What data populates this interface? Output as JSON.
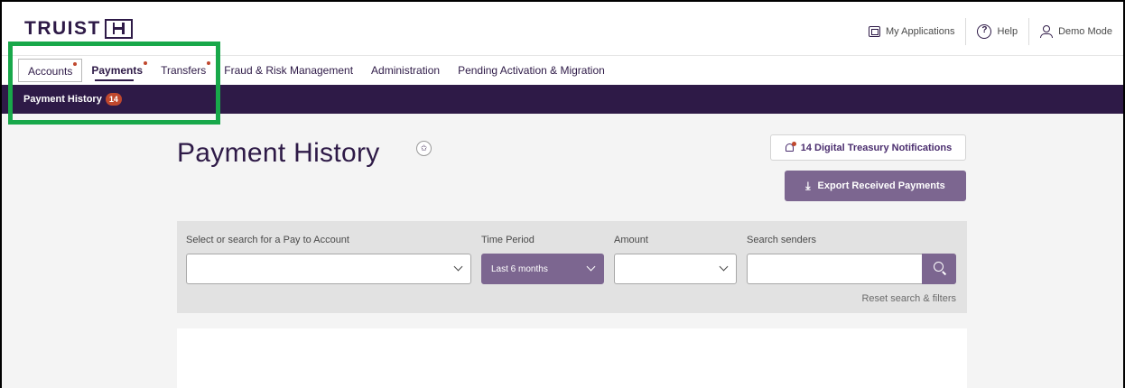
{
  "brand": {
    "name": "TRUIST"
  },
  "utility": {
    "my_applications": "My Applications",
    "help": "Help",
    "demo_mode": "Demo Mode"
  },
  "nav": {
    "items": [
      {
        "label": "Accounts"
      },
      {
        "label": "Payments"
      },
      {
        "label": "Transfers"
      },
      {
        "label": "Fraud & Risk Management"
      },
      {
        "label": "Administration"
      },
      {
        "label": "Pending Activation & Migration"
      }
    ]
  },
  "subnav": {
    "label": "Payment History",
    "badge": "14"
  },
  "page": {
    "title": "Payment History",
    "notifications_button": "14 Digital Treasury Notifications",
    "export_button": "Export Received Payments"
  },
  "filters": {
    "pay_to_account_label": "Select or search for a Pay to Account",
    "pay_to_account_value": "",
    "time_period_label": "Time Period",
    "time_period_value": "Last 6 months",
    "amount_label": "Amount",
    "amount_value": "",
    "search_senders_label": "Search senders",
    "search_senders_value": "",
    "reset_link": "Reset search & filters"
  },
  "colors": {
    "brand_purple": "#2e1a47",
    "accent_purple": "#7c6690",
    "badge_red": "#c0482e",
    "highlight_green": "#18a84a"
  }
}
